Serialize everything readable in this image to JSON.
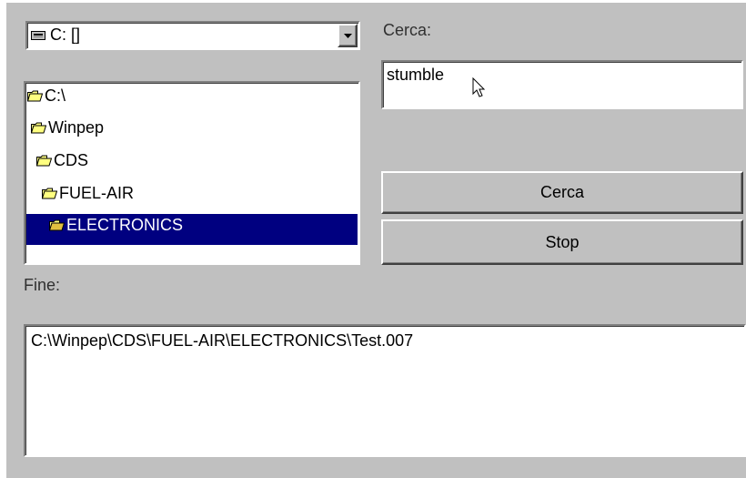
{
  "drive": {
    "selected": "C: []",
    "icon": "drive-icon"
  },
  "folders": [
    {
      "label": "C:\\",
      "icon": "open-folder-icon"
    },
    {
      "label": "Winpep",
      "icon": "open-folder-icon"
    },
    {
      "label": "CDS",
      "icon": "open-folder-icon"
    },
    {
      "label": "FUEL-AIR",
      "icon": "open-folder-icon"
    },
    {
      "label": "ELECTRONICS",
      "icon": "open-folder-icon",
      "selected": true
    }
  ],
  "search": {
    "label": "Cerca:",
    "value": "stumble"
  },
  "buttons": {
    "search_label": "Cerca",
    "stop_label": "Stop"
  },
  "results": {
    "label": "Fine:",
    "items": [
      "C:\\Winpep\\CDS\\FUEL-AIR\\ELECTRONICS\\Test.007"
    ]
  },
  "colors": {
    "face": "#c0c0c0",
    "selection": "#000080",
    "folder_yellow": "#ffff80"
  }
}
